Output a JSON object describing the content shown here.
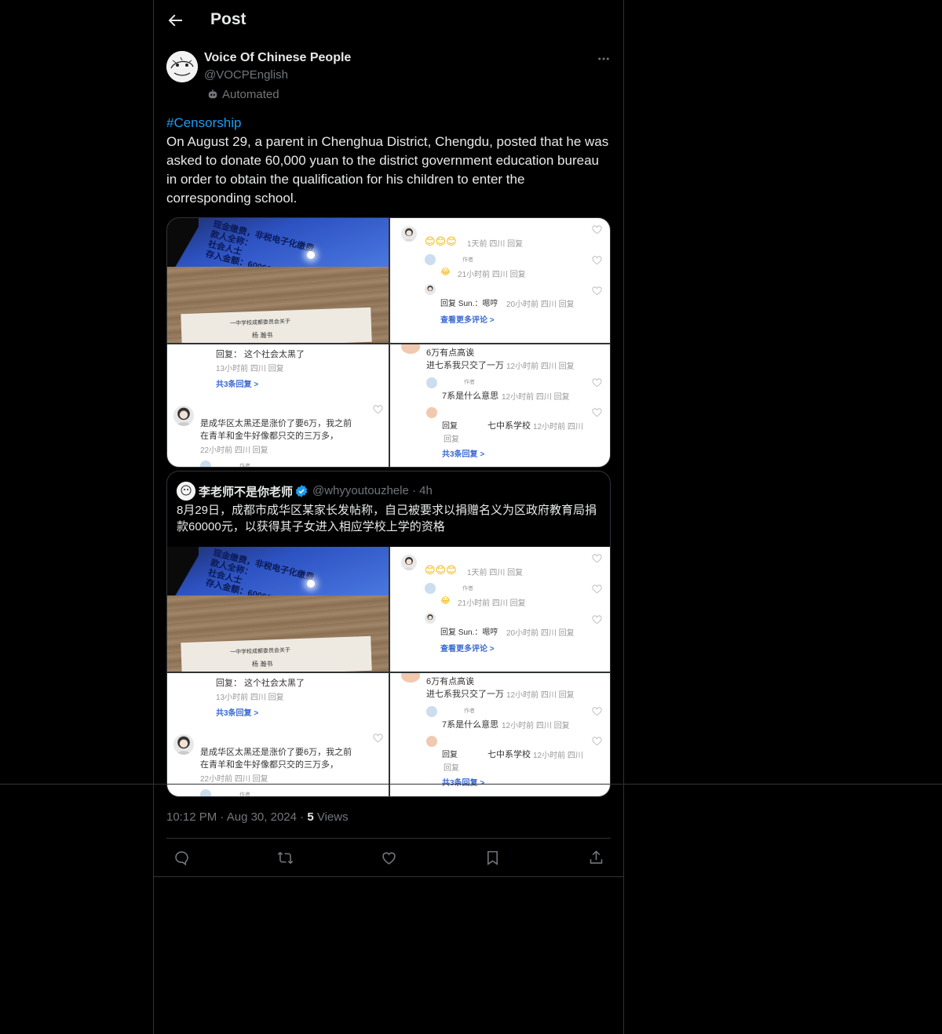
{
  "header": {
    "title": "Post",
    "back_icon": "arrow-left-icon"
  },
  "author": {
    "name": "Voice Of Chinese People",
    "handle": "@VOCPEnglish",
    "label": "Automated"
  },
  "post": {
    "hashtag": "#Censorship",
    "text": "On August 29, a parent in Chenghua District, Chengdu, posted that he was asked to donate 60,000 yuan to the district government education bureau in order to obtain the qualification for his children to enter the corresponding school."
  },
  "media": {
    "photo": {
      "screen_lines": [
        "现金缴费，非税电子化缴费",
        "款人全称：",
        "社会人士",
        "存入金额：60000.00"
      ],
      "paper_line": "一中学校成都委员会关于",
      "paper_name": "杨 瀚书"
    },
    "comments_a": {
      "row1_meta": "1天前 四川 回复",
      "row2_tag": "作者",
      "row2_meta": "21小时前 四川 回复",
      "row3_text": "回复 Sun.：嗯哼",
      "row3_meta": "20小时前 四川 回复",
      "more_link": "查看更多评论 >"
    },
    "comments_b": {
      "reply_text": "回复：  这个社会太黑了",
      "reply_meta": "13小时前 四川 回复",
      "replies_link": "共3条回复 >",
      "comment_line1": "是成华区太黑还是涨价了要6万，我之前",
      "comment_line2": "在青羊和金牛好像都只交的三万多，",
      "comment_meta": "22小时前 四川 回复",
      "tag": "作者"
    },
    "comments_c": {
      "line1": "6万有点高诶",
      "line2": "进七系我只交了一万",
      "line2_meta": "12小时前 四川 回复",
      "tag": "作者",
      "row2_text": "7系是什么意思",
      "row2_meta": "12小时前 四川 回复",
      "row3_reply": "回复",
      "row3_text": "七中系学校",
      "row3_meta": "12小时前 四川",
      "row3_sub": "回复",
      "replies_link": "共3条回复 >"
    }
  },
  "quote": {
    "name": "李老师不是你老师",
    "handle": "@whyyoutouzhele",
    "time": "4h",
    "text": "8月29日，成都市成华区某家长发帖称，自己被要求以捐赠名义为区政府教育局捐款60000元，以获得其子女进入相应学校上学的资格"
  },
  "meta": {
    "time": "10:12 PM",
    "date": "Aug 30, 2024",
    "views_count": "5",
    "views_label": "Views"
  },
  "actions": [
    "reply-icon",
    "retweet-icon",
    "like-icon",
    "bookmark-icon",
    "share-icon"
  ],
  "colors": {
    "background": "#000000",
    "accent": "#1d9bf0",
    "muted": "#71767b",
    "border": "#2f3336",
    "text": "#e7e9ea"
  }
}
